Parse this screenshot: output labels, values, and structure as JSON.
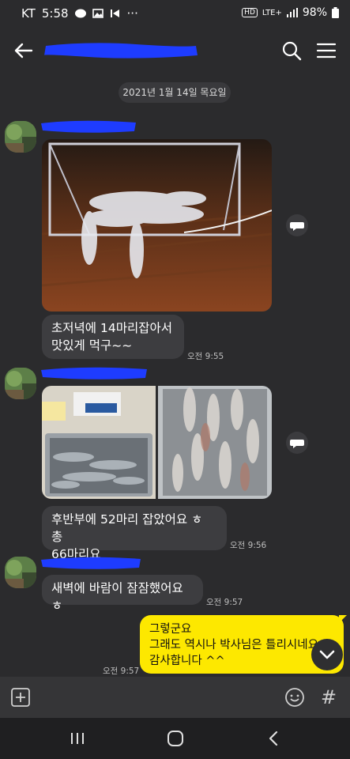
{
  "status_bar": {
    "carrier": "KT",
    "time": "5:58",
    "dots": "···",
    "hd": "HD",
    "network": "LTE+",
    "battery": "98%"
  },
  "header": {
    "back_icon": "arrow-left-icon",
    "search_icon": "search-icon",
    "menu_icon": "hamburger-menu-icon"
  },
  "date_divider": "2021년 1월 14일 목요일",
  "messages": [
    {
      "text_line1": "초저녁에 14마리잡아서",
      "text_line2": "맛있게 먹구~~",
      "time": "오전 9:55"
    },
    {
      "text_line1": "후반부에 52마리 잡았어요 ㅎ 총",
      "text_line2": "66마리요",
      "time": "오전 9:56"
    },
    {
      "text": "새벽에 바람이 잠잠했어요ㅎ",
      "time": "오전 9:57"
    }
  ],
  "my_message": {
    "line1": "그렇군요",
    "line2": "그래도  역시나 박사님은 틀리시네요",
    "line3": "감사합니다 ^^",
    "time": "오전 9:57"
  },
  "colors": {
    "background": "#2b2b2d",
    "bubble": "#3d3d40",
    "my_bubble": "#fde800",
    "redaction": "#1e3cff"
  }
}
